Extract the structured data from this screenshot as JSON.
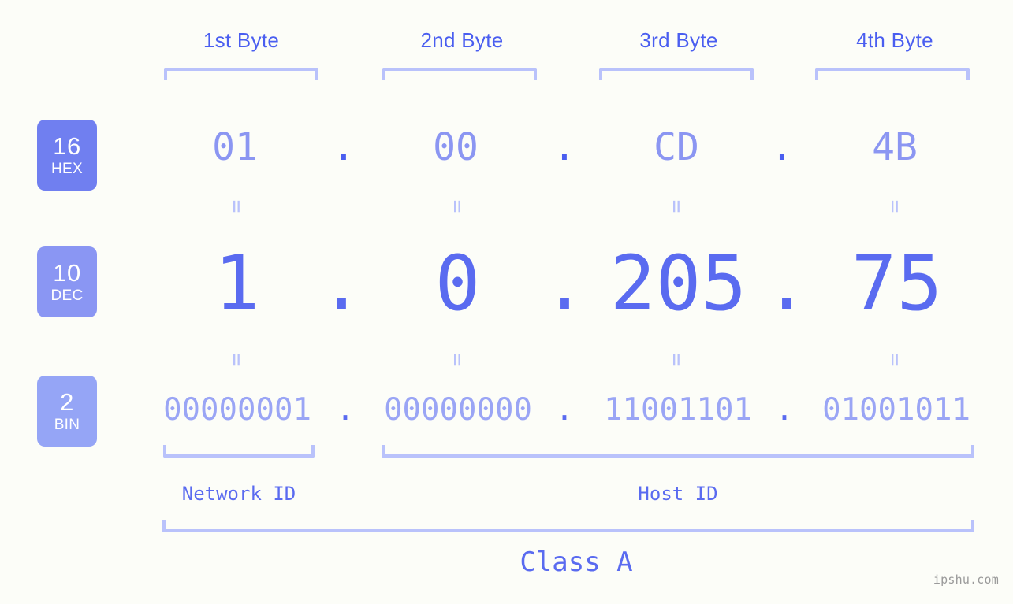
{
  "meta": {
    "background": "#fcfdf8",
    "accent": "#5a6bf0",
    "accent_light": "#b9c2fb",
    "watermark": "ipshu.com"
  },
  "byte_headers": [
    {
      "label": "1st Byte"
    },
    {
      "label": "2nd Byte"
    },
    {
      "label": "3rd Byte"
    },
    {
      "label": "4th Byte"
    }
  ],
  "bases": [
    {
      "num": "16",
      "name": "HEX",
      "color": "#707ff0"
    },
    {
      "num": "10",
      "name": "DEC",
      "color": "#8a96f3"
    },
    {
      "num": "2",
      "name": "BIN",
      "color": "#95a5f6"
    }
  ],
  "rows": {
    "hex": {
      "values": [
        "01",
        "00",
        "CD",
        "4B"
      ],
      "separator": "."
    },
    "dec": {
      "values": [
        "1",
        "0",
        "205",
        "75"
      ],
      "separator": "."
    },
    "bin": {
      "values": [
        "00000001",
        "00000000",
        "11001101",
        "01001011"
      ],
      "separator": "."
    }
  },
  "equals": {
    "glyph": "="
  },
  "segments": {
    "network_id": "Network ID",
    "host_id": "Host ID",
    "class": "Class A"
  },
  "address": {
    "hex": "01.00.CD.4B",
    "dec": "1.0.205.75",
    "bin": "00000001.00000000.11001101.01001011"
  }
}
